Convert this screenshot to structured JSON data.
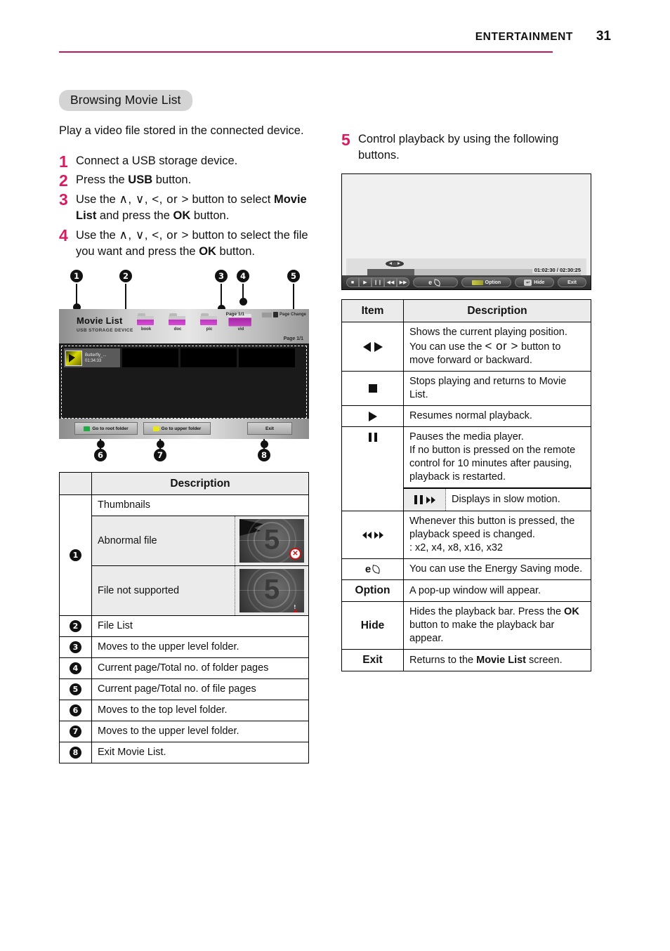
{
  "header": {
    "title": "ENTERTAINMENT",
    "page_number": "31"
  },
  "section": {
    "heading": "Browsing Movie List",
    "lead": "Play a video file stored in the connected device."
  },
  "steps_left": [
    {
      "num": "1",
      "html": "Connect a USB storage device."
    },
    {
      "num": "2",
      "html": "Press the <b>USB</b> button."
    },
    {
      "num": "3",
      "html": "Use the <span class=\"kbd\">&#8743;, &#8744;, &lt;, or &gt;</span> button to select <b>Movie List</b> and press the <b>OK</b> button."
    },
    {
      "num": "4",
      "html": "Use the <span class=\"kbd\">&#8743;, &#8744;, &lt;, or &gt;</span> button to select the file you want and press the <b>OK</b> button."
    }
  ],
  "steps_right": [
    {
      "num": "5",
      "html": "Control playback by using the following buttons."
    }
  ],
  "movie_list_mock": {
    "title": "Movie List",
    "subtitle": "USB STORAGE DEVICE",
    "folders": [
      {
        "name": "book",
        "selected": false
      },
      {
        "name": "doc",
        "selected": false
      },
      {
        "name": "pic",
        "selected": false
      },
      {
        "name": "vid",
        "selected": true
      }
    ],
    "folder_page": "Page 1/1",
    "page_change_label": "Page Change",
    "file_page": "Page 1/1",
    "file_entry": {
      "name": "Butterfly_...",
      "duration": "01:34:33"
    },
    "buttons": {
      "root": "Go to root folder",
      "upper": "Go to upper folder",
      "exit": "Exit"
    }
  },
  "callouts_top": [
    "1",
    "2",
    "3",
    "4",
    "5"
  ],
  "callouts_bottom": [
    "6",
    "7",
    "8"
  ],
  "left_table": {
    "header_blank": "",
    "header_description": "Description",
    "rows": [
      {
        "num": "1",
        "text": "Thumbnails",
        "sub": [
          {
            "label": "Abnormal file",
            "badge": "x"
          },
          {
            "label": "File not supported",
            "badge": "warning"
          }
        ]
      },
      {
        "num": "2",
        "text": "File List"
      },
      {
        "num": "3",
        "text": "Moves to the upper level folder."
      },
      {
        "num": "4",
        "text": "Current page/Total no. of folder pages"
      },
      {
        "num": "5",
        "text": "Current page/Total no. of file pages"
      },
      {
        "num": "6",
        "text": "Moves to the top level folder."
      },
      {
        "num": "7",
        "text": "Moves to the upper level folder."
      },
      {
        "num": "8",
        "text": "Exit Movie List."
      }
    ],
    "thumb_sample_digit": "5"
  },
  "player_mock": {
    "time_current": "01:02:30",
    "time_total": "02:30:25",
    "time_display": "01:02:30 / 02:30:25",
    "energy_label": "",
    "option_label": "Option",
    "hide_label": "Hide",
    "exit_label": "Exit"
  },
  "right_table": {
    "header_item": "Item",
    "header_description": "Description",
    "rows": [
      {
        "icon": "seek-left-right",
        "html": "Shows the current playing position.<br>You can use the <span class=\"kbd\">&lt; or &gt;</span> button to move forward or backward."
      },
      {
        "icon": "stop",
        "html": "Stops playing and returns to Movie List."
      },
      {
        "icon": "play",
        "html": "Resumes normal playback."
      },
      {
        "icon": "pause",
        "html": "Pauses the media player.<br>If no button is pressed on the remote control for 10 minutes after pausing, playback is restarted.",
        "nested": {
          "icon": "pause-fastforward",
          "text": "Displays in slow motion."
        }
      },
      {
        "icon": "rewind-fastforward",
        "html": "Whenever this button is pressed, the playback speed is changed.<br>: x2, x4, x8, x16, x32"
      },
      {
        "icon": "energy-saving",
        "html": "You can use the Energy Saving mode."
      },
      {
        "label": "Option",
        "html": "A pop-up window will appear."
      },
      {
        "label": "Hide",
        "html": "Hides the playback bar. Press the <b>OK</b> button to make the playback bar appear."
      },
      {
        "label": "Exit",
        "html": "Returns to the <b>Movie List</b> screen."
      }
    ]
  },
  "colors": {
    "accent": "#d81b60",
    "rule": "#c2185b",
    "chip_bg": "#d4d4d4",
    "table_header_bg": "#ebebeb"
  }
}
